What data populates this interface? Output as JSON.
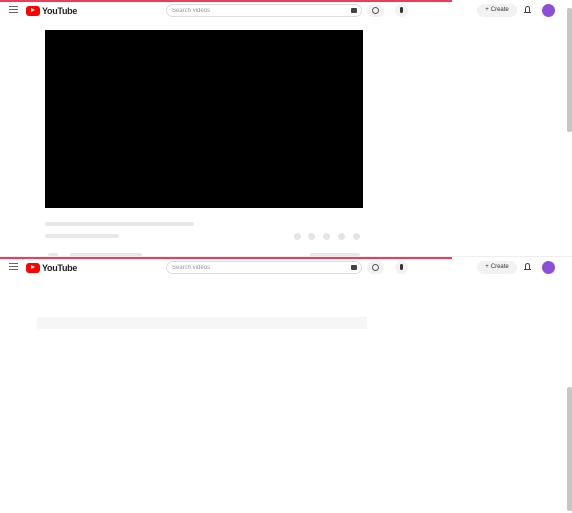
{
  "app": {
    "logo_text": "YouTube",
    "search_placeholder": "Search videos",
    "create_label": "Create",
    "colors": {
      "brand": "#ff0000",
      "loading_bar": "#f03b5a",
      "avatar": "#8e4fd6"
    }
  },
  "icons": {
    "menu": "menu-icon",
    "search": "search-icon",
    "keyboard": "keyboard-icon",
    "mic": "mic-icon",
    "create": "plus-icon",
    "notifications": "bell-icon"
  }
}
